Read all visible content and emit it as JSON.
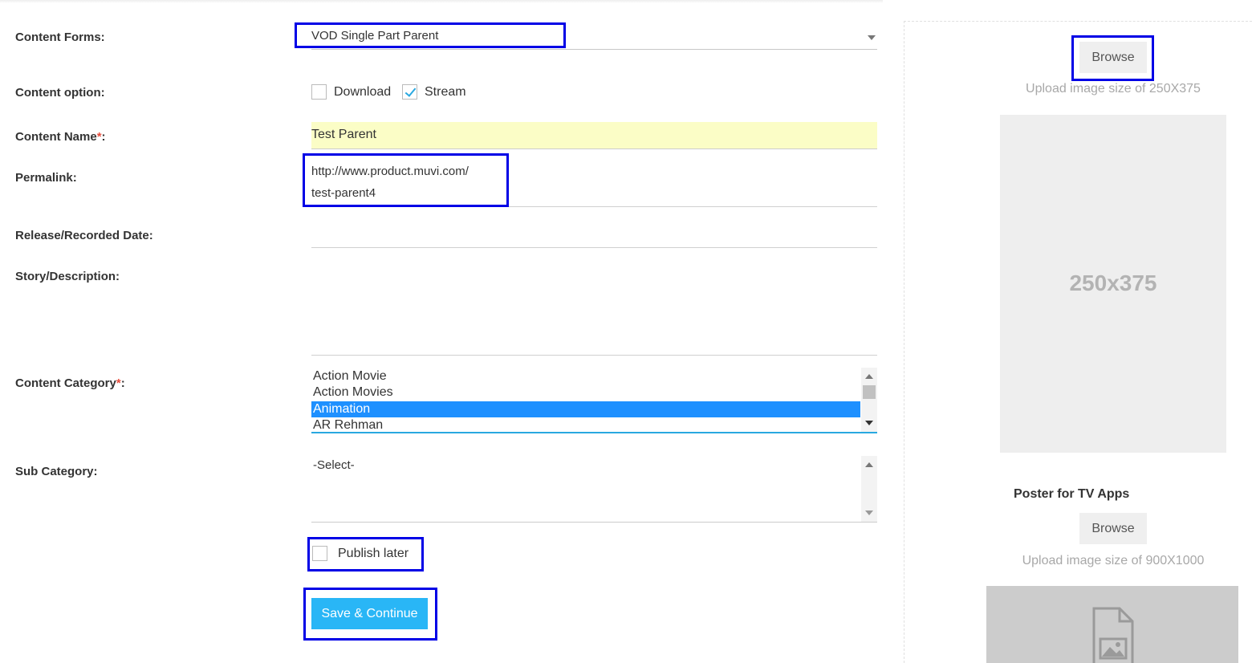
{
  "form": {
    "content_forms_label": "Content Forms:",
    "content_forms_value": "VOD Single Part Parent",
    "content_option_label": "Content option:",
    "download_label": "Download",
    "download_checked": false,
    "stream_label": "Stream",
    "stream_checked": true,
    "content_name_label": "Content Name",
    "required_mark": "*",
    "colon": ":",
    "content_name_value": "Test Parent",
    "permalink_label": "Permalink:",
    "permalink_line1": "http://www.product.muvi.com/",
    "permalink_line2": "test-parent4",
    "release_date_label": "Release/Recorded Date:",
    "story_label": "Story/Description:",
    "content_category_label": "Content Category",
    "categories": [
      "Action Movie",
      "Action Movies",
      "Animation",
      "AR Rehman"
    ],
    "selected_category": "Animation",
    "sub_category_label": "Sub Category:",
    "sub_category_value": "-Select-",
    "publish_later_label": "Publish later",
    "publish_later_checked": false,
    "save_button": "Save & Continue"
  },
  "side": {
    "browse_label": "Browse",
    "upload_hint_poster": "Upload image size of 250X375",
    "poster_placeholder": "250x375",
    "tv_title": "Poster for TV Apps",
    "browse_label_tv": "Browse",
    "upload_hint_tv": "Upload image size of 900X1000"
  },
  "colors": {
    "accent": "#29b6f6",
    "highlight_box": "#0000e6",
    "selected_item": "#1e90ff",
    "name_field_bg": "#fbfdc6",
    "required": "#e74c3c"
  }
}
